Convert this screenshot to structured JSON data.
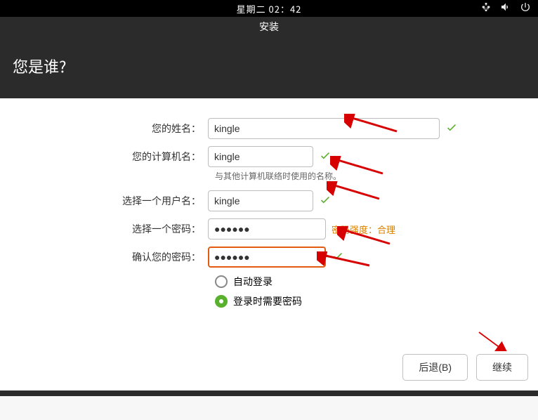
{
  "topbar": {
    "clock": "星期二 02：42"
  },
  "titlebar": {
    "title": "安装"
  },
  "header": {
    "title": "您是谁?"
  },
  "form": {
    "name": {
      "label": "您的姓名：",
      "value": "kingle"
    },
    "hostname": {
      "label": "您的计算机名：",
      "value": "kingle",
      "hint": "与其他计算机联络时使用的名称。"
    },
    "username": {
      "label": "选择一个用户名：",
      "value": "kingle"
    },
    "password": {
      "label": "选择一个密码：",
      "value": "●●●●●●",
      "strength": "密码强度：合理"
    },
    "confirm": {
      "label": "确认您的密码：",
      "value": "●●●●●●"
    },
    "auto_login": "自动登录",
    "require_password": "登录时需要密码"
  },
  "footer": {
    "back": "后退(B)",
    "continue": "继续"
  }
}
